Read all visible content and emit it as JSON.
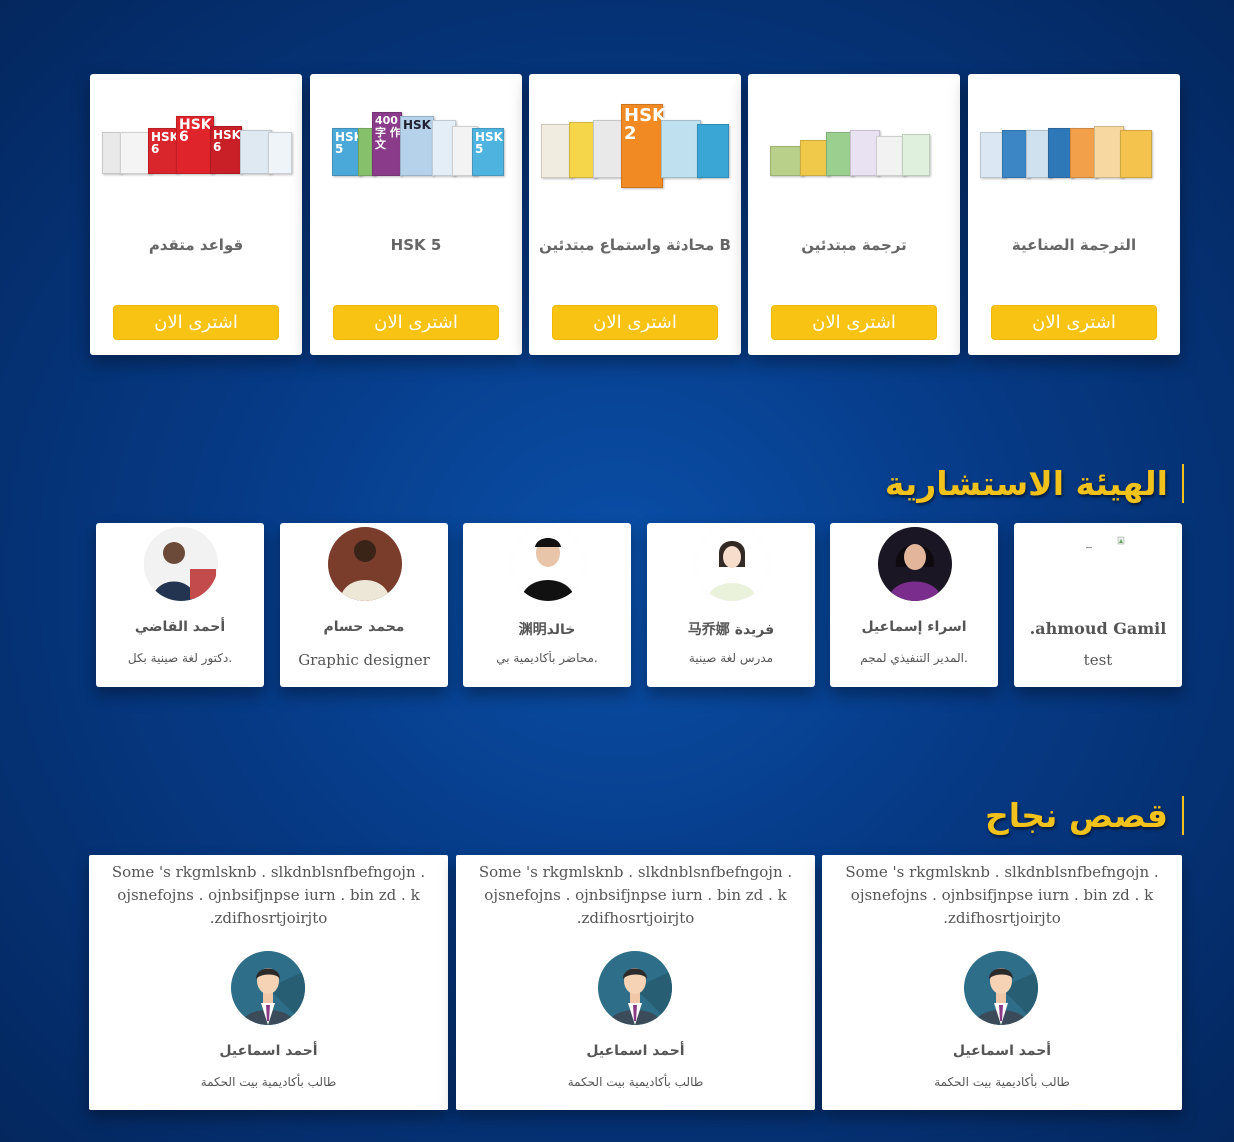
{
  "courses": {
    "buy_label": "اشترى الان",
    "items": [
      {
        "title": "قواعد متقدم",
        "book_text": [
          "HSK 6",
          "HSK 6",
          "HSK 6"
        ]
      },
      {
        "title": "HSK 5",
        "book_text": [
          "HSK 5",
          "400字 作文",
          "HSK",
          "HSK 5"
        ]
      },
      {
        "title": "محادثة واستماع مبتدئين B",
        "book_text": [
          "HSK 2"
        ]
      },
      {
        "title": "ترجمة مبتدئين",
        "book_text": []
      },
      {
        "title": "الترجمة الصناعية",
        "book_text": []
      }
    ]
  },
  "advisory": {
    "heading": "الهيئة الاستشارية",
    "members": [
      {
        "name": "أحمد القاضي",
        "role": "دكتور لغة صينية بكل."
      },
      {
        "name": "محمد حسام",
        "role": "Graphic designer"
      },
      {
        "name": "渊明خالد",
        "role": "محاضر بأكاديمية بي."
      },
      {
        "name": "马乔娜 فريدة",
        "role": "مدرس لغة صينية"
      },
      {
        "name": "اسراء إسماعيل",
        "role": "المدير التنفيذي لمجم."
      },
      {
        "name": ".ahmoud Gamil",
        "role": "test"
      }
    ]
  },
  "success": {
    "heading": "قصص نجاح",
    "stories": [
      {
        "text": "Some 's rkgmlsknb . slkdnblsnfbefngojn . ojsnefojns . ojnbsifjnpse iurn . bin zd . k .zdifhosrtjoirjto",
        "name": "أحمد اسماعيل",
        "role": "طالب بأكاديمية بيت الحكمة"
      },
      {
        "text": "Some 's rkgmlsknb . slkdnblsnfbefngojn . ojsnefojns . ojnbsifjnpse iurn . bin zd . k .zdifhosrtjoirjto",
        "name": "أحمد اسماعيل",
        "role": "طالب بأكاديمية بيت الحكمة"
      },
      {
        "text": "Some 's rkgmlsknb . slkdnblsnfbefngojn . ojsnefojns . ojnbsifjnpse iurn . bin zd . k .zdifhosrtjoirjto",
        "name": "أحمد اسماعيل",
        "role": "طالب بأكاديمية بيت الحكمة"
      }
    ]
  },
  "colors": {
    "accent": "#f9c313",
    "background": "#063a86"
  }
}
